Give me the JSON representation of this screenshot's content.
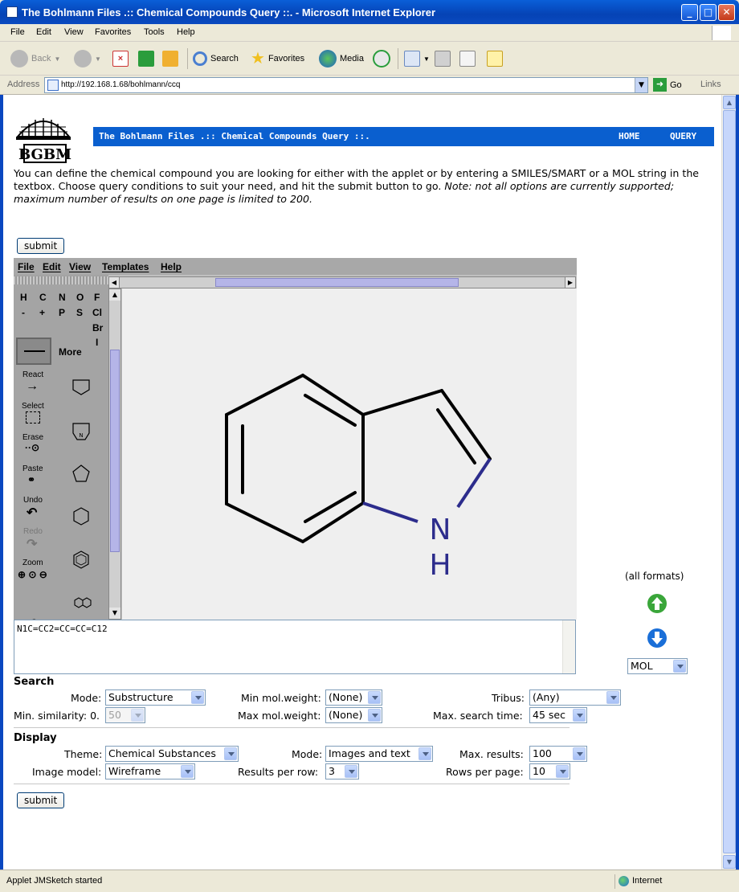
{
  "window": {
    "title": "The Bohlmann Files .:: Chemical Compounds Query ::. - Microsoft Internet Explorer",
    "buttons": {
      "minimize": "_",
      "maximize": "□",
      "close": "✕"
    }
  },
  "menu": [
    "File",
    "Edit",
    "View",
    "Favorites",
    "Tools",
    "Help"
  ],
  "toolbar": {
    "back": "Back",
    "search": "Search",
    "favorites": "Favorites",
    "media": "Media"
  },
  "address": {
    "label": "Address",
    "url": "http://192.168.1.68/bohlmann/ccq",
    "go": "Go",
    "links": "Links"
  },
  "page": {
    "logo_text": "BGBM",
    "header_title": "The Bohlmann Files .:: Chemical Compounds Query ::.",
    "nav": [
      "HOME",
      "QUERY"
    ],
    "intro": "You can define the chemical compound you are looking for either with the applet or by entering a SMILES/SMART or a MOL string in the textbox. Choose query conditions to suit your need, and hit the submit button to go. ",
    "intro_note": "Note: not all options are currently supported; maximum number of results on one page is limited to 200.",
    "submit_label": "submit"
  },
  "applet": {
    "menu": [
      "File",
      "Edit",
      "View",
      "Templates",
      "Help"
    ],
    "elements_row1": [
      "H",
      "C",
      "N",
      "O",
      "F"
    ],
    "elements_row2": [
      "-",
      "+",
      "P",
      "S",
      "Cl"
    ],
    "element_br": "Br",
    "element_i": "I",
    "more_label": "More",
    "tools": [
      "React",
      "Select",
      "Erase",
      "Paste",
      "Undo",
      "Redo",
      "Zoom"
    ],
    "help_label": "?",
    "atom_n": "N",
    "atom_h": "H"
  },
  "smiles": "N1C=CC2=CC=CC=C12",
  "formats": {
    "label": "(all formats)",
    "selected": "MOL"
  },
  "search": {
    "title": "Search",
    "mode_label": "Mode:",
    "mode_value": "Substructure",
    "min_mw_label": "Min mol.weight:",
    "min_mw_value": "(None)",
    "tribus_label": "Tribus:",
    "tribus_value": "(Any)",
    "min_sim_label": "Min. similarity: 0.",
    "min_sim_value": "50",
    "max_mw_label": "Max mol.weight:",
    "max_mw_value": "(None)",
    "max_time_label": "Max. search time:",
    "max_time_value": "45 sec"
  },
  "display": {
    "title": "Display",
    "theme_label": "Theme:",
    "theme_value": "Chemical Substances",
    "mode_label": "Mode:",
    "mode_value": "Images and text",
    "max_results_label": "Max. results:",
    "max_results_value": "100",
    "image_model_label": "Image model:",
    "image_model_value": "Wireframe",
    "per_row_label": "Results per row:",
    "per_row_value": "3",
    "rows_label": "Rows per page:",
    "rows_value": "10"
  },
  "status": {
    "text": "Applet JMSketch started",
    "zone": "Internet"
  },
  "colors": {
    "header_blue": "#0a5fcf",
    "xp_blue": "#0a47c0",
    "atom_n": "#2c2c8c",
    "arrow_green": "#3aa63a",
    "arrow_blue": "#1a6fd8"
  }
}
